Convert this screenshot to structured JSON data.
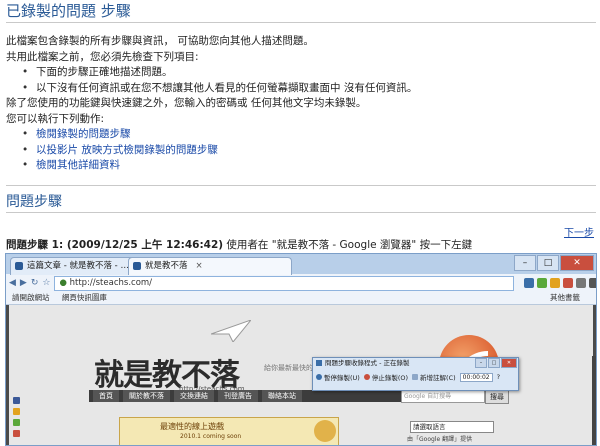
{
  "header": {
    "title": "已錄製的問題 步驟"
  },
  "intro": {
    "line1": "此檔案包含錄製的所有步驟與資訊， 可協助您向其他人描述問題。",
    "line2": "共用此檔案之前，您必須先檢查下列項目:",
    "checks": [
      "下面的步驟正確地描述問題。",
      "以下沒有任何資訊或在您不想讓其他人看見的任何螢幕擷取畫面中 沒有任何資訊。"
    ],
    "line3": "除了您使用的功能鍵與快速鍵之外，您輸入的密碼或 任何其他文字均未錄製。",
    "line4": "您可以執行下列動作:",
    "actions": [
      "檢閱錄製的問題步驟",
      "以投影片 放映方式檢閱錄製的問題步驟",
      "檢閱其他詳細資料"
    ]
  },
  "steps": {
    "title": "問題步驟",
    "next_link": "下一步",
    "step1_label": "問題步驟 1: (2009/12/25 上午 12:46:42)",
    "step1_text": " 使用者在 \"就是教不落 - Google 瀏覽器\" 按一下左鍵"
  },
  "browser": {
    "tabs": [
      "這篇文章 - 就是教不落 - …",
      "就是教不落"
    ],
    "url": "http://steachs.com/",
    "bookmarks": [
      "請開啟網站",
      "網頁快訊圖庫"
    ],
    "other_bookmarks": "其他書籤",
    "site": {
      "logo": "就是教不落",
      "logo_url": "http://steachs.com",
      "tagline": "給你最新最快的電腦軟體與網路應用資訊",
      "menu": [
        "首頁",
        "關於教不落",
        "交換連結",
        "刊登廣告",
        "聯絡本站"
      ],
      "search_placeholder": "Google 自訂搜尋",
      "search_button": "搜尋",
      "ad_title": "最適性的線上遊戲",
      "ad_sub": "2010.1 coming soon",
      "lang_select": "請選取語言",
      "lang_by": "由「Google 翻譯」提供"
    }
  },
  "recorder": {
    "title": "問題步驟收錄程式 - 正在錄製",
    "pause": "暫停錄製(U)",
    "stop": "停止錄製(O)",
    "comment": "新增註解(C)",
    "timer": "00:00:02"
  },
  "colors": {
    "heading": "#2a5a96",
    "link": "#1a4aa8"
  }
}
